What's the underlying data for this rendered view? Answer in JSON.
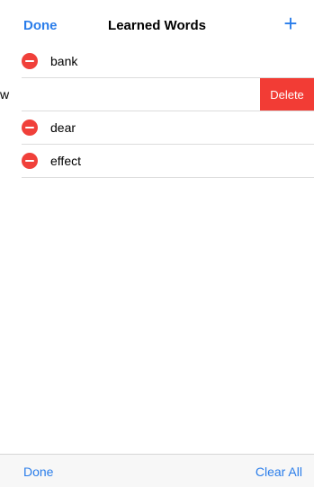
{
  "nav": {
    "done_label": "Done",
    "title": "Learned Words",
    "add_label": "+"
  },
  "words": [
    {
      "text": "bank",
      "state": "edit"
    },
    {
      "text": "w",
      "state": "swiped",
      "action": "Delete"
    },
    {
      "text": "dear",
      "state": "edit"
    },
    {
      "text": "effect",
      "state": "edit"
    }
  ],
  "toolbar": {
    "done_label": "Done",
    "clear_all_label": "Clear All"
  },
  "colors": {
    "accent": "#2a7dea",
    "destructive": "#f23c35"
  },
  "icons": {
    "add": "plus-icon",
    "remove": "minus-circle-icon"
  }
}
